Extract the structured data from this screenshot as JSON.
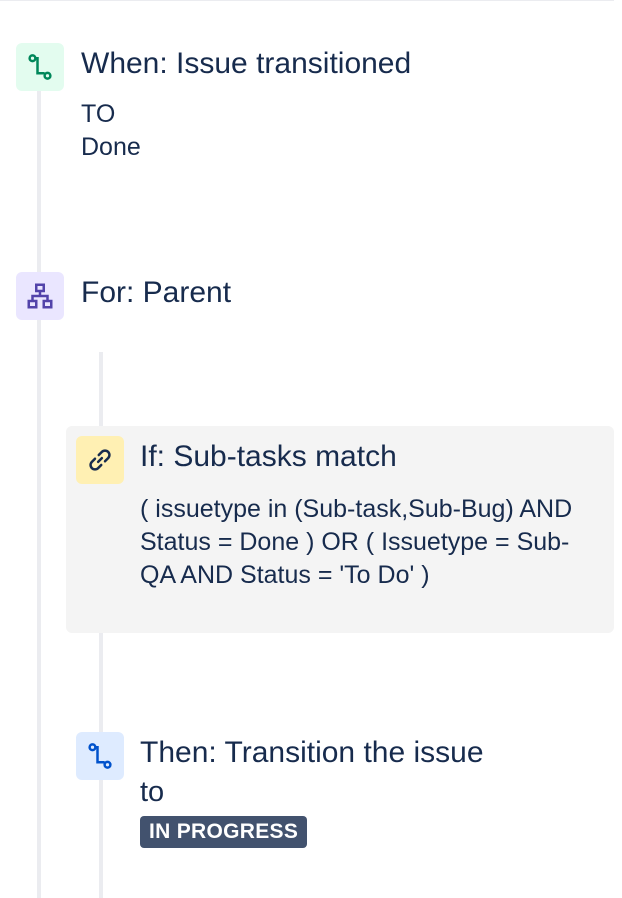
{
  "trigger": {
    "icon": "transition-icon",
    "title": "When: Issue transitioned",
    "to_label": "TO",
    "to_value": "Done"
  },
  "branch": {
    "icon": "hierarchy-icon",
    "title": "For: Parent"
  },
  "condition": {
    "icon": "link-icon",
    "title": "If: Sub-tasks match",
    "query": "( issuetype in (Sub-task,Sub-Bug) AND Status = Done ) OR ( Issuetype = Sub-QA AND Status = 'To Do' )"
  },
  "action": {
    "icon": "transition-icon",
    "title": "Then: Transition the issue",
    "to_label": "to",
    "status": "IN PROGRESS"
  },
  "colors": {
    "trigger_bg": "#e3fcef",
    "trigger_icon": "#00875a",
    "branch_bg": "#eae6ff",
    "branch_icon": "#5243aa",
    "condition_bg": "#fff0b3",
    "condition_icon": "#172b4d",
    "action_bg": "#deebff",
    "action_icon": "#0052cc",
    "status_bg": "#42526e"
  }
}
